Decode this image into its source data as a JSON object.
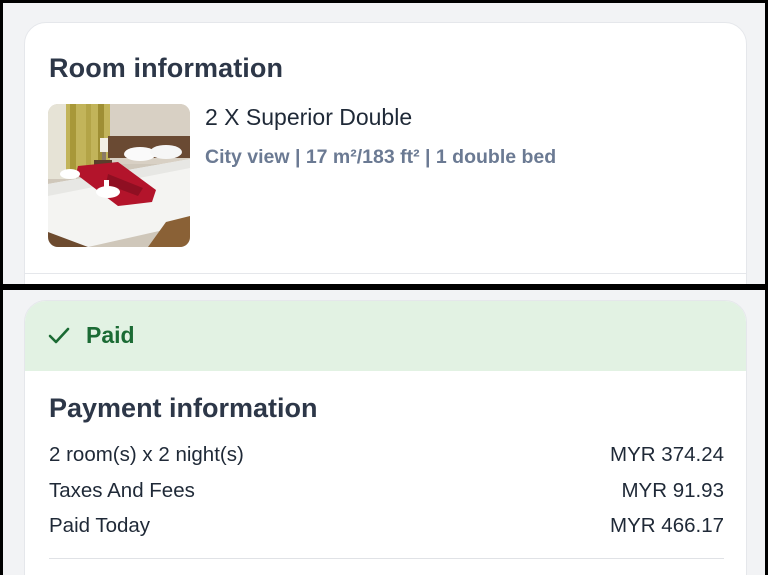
{
  "room_section": {
    "title": "Room information",
    "room_name": "2 X Superior Double",
    "room_details": "City view | 17 m²/183 ft² | 1 double bed",
    "photo_icon": "hotel-room-photo"
  },
  "payment_status": {
    "icon": "check-icon",
    "label": "Paid",
    "color": "#1b6b34",
    "background": "#e2f2e3"
  },
  "payment_section": {
    "title": "Payment information",
    "rows": [
      {
        "label": "2 room(s) x 2 night(s)",
        "value": "MYR 374.24"
      },
      {
        "label": "Taxes And Fees",
        "value": "MYR 91.93"
      },
      {
        "label": "Paid Today",
        "value": "MYR 466.17"
      }
    ]
  },
  "colors": {
    "details_text": "#6b7a93",
    "heading_text": "#2d3748",
    "page_background": "#f2f3f5"
  }
}
